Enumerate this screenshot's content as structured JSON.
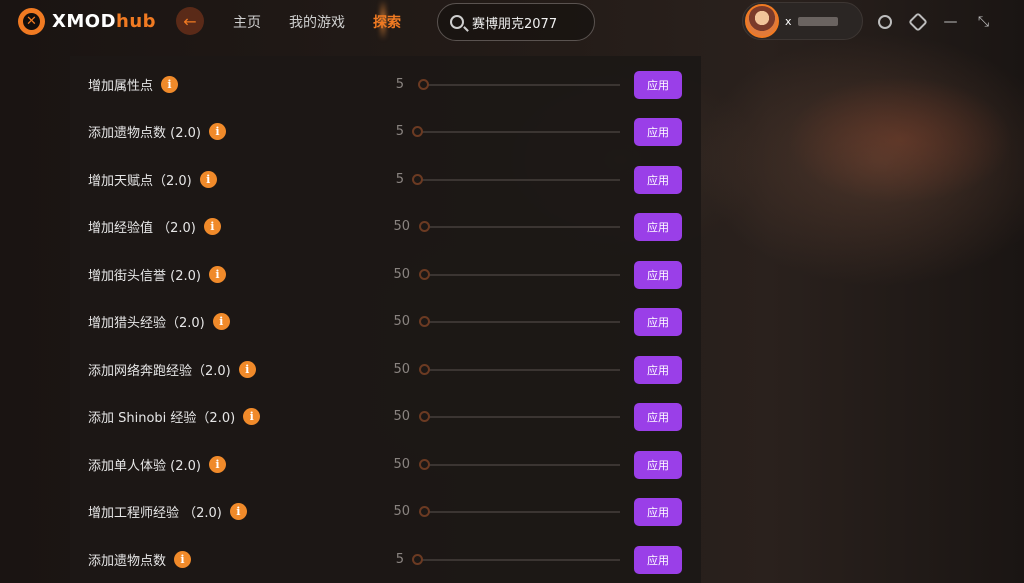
{
  "app": {
    "brand_main": "XMODhub",
    "brand_a": "XMOD",
    "brand_b": "hub"
  },
  "nav": {
    "home": "主页",
    "my_games": "我的游戏",
    "explore": "探索"
  },
  "search": {
    "value": "赛博朋克2077"
  },
  "user": {
    "name": "x"
  },
  "colors": {
    "accent": "#f07a22",
    "apply_button": "#9a3fe8",
    "info_badge": "#f08a2a"
  },
  "apply_label": "应用",
  "cheats": [
    {
      "label": "增加属性点",
      "value": "5"
    },
    {
      "label": "添加遗物点数 (2.0)",
      "value": "5"
    },
    {
      "label": "增加天赋点（2.0)",
      "value": "5"
    },
    {
      "label": "增加经验值 （2.0)",
      "value": "50"
    },
    {
      "label": "增加街头信誉 (2.0)",
      "value": "50"
    },
    {
      "label": "增加猎头经验（2.0)",
      "value": "50"
    },
    {
      "label": "添加网络奔跑经验（2.0)",
      "value": "50"
    },
    {
      "label": "添加 Shinobi 经验（2.0)",
      "value": "50"
    },
    {
      "label": "添加单人体验 (2.0)",
      "value": "50"
    },
    {
      "label": "增加工程师经验 （2.0)",
      "value": "50"
    },
    {
      "label": "添加遗物点数",
      "value": "5"
    }
  ]
}
